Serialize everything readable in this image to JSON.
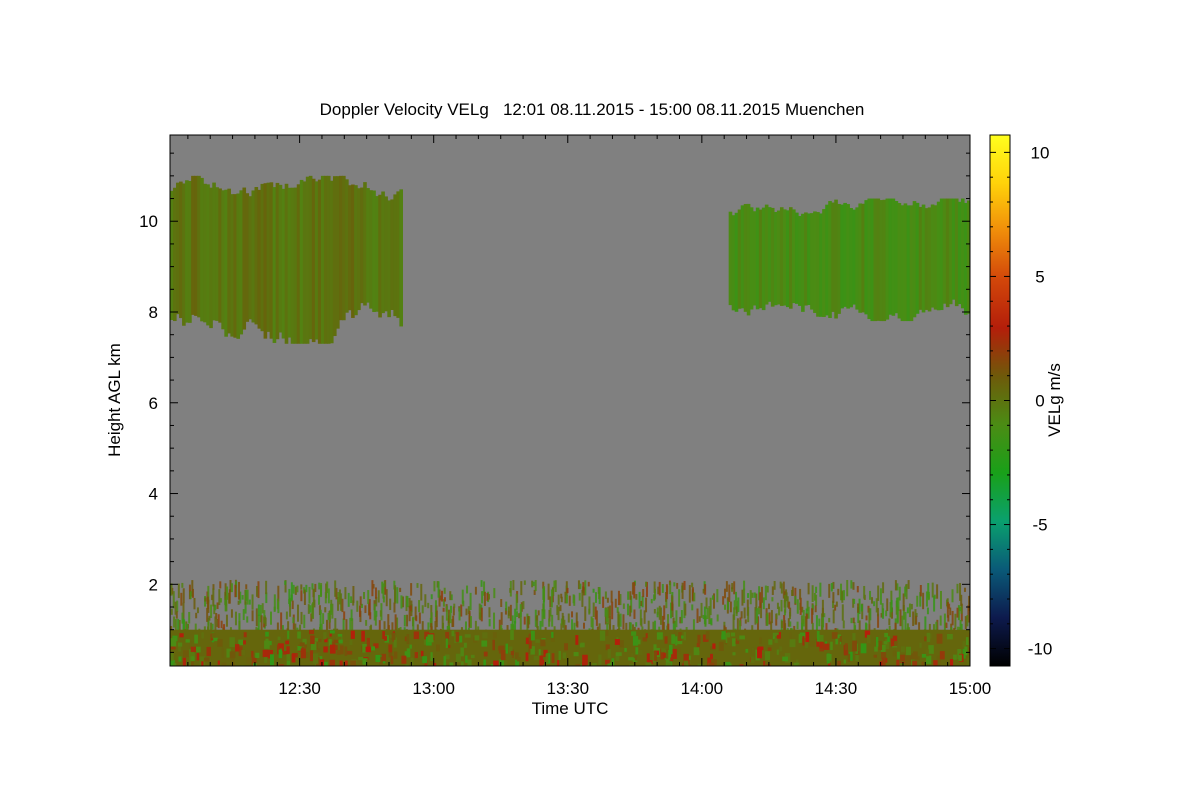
{
  "chart_data": {
    "type": "heatmap",
    "title": "Doppler Velocity VELg   12:01 08.11.2015 - 15:00 08.11.2015 Muenchen",
    "xlabel": "Time UTC",
    "ylabel": "Height AGL km",
    "colorbar_label": "VELg m/s",
    "xlim": [
      "12:01",
      "15:00"
    ],
    "ylim": [
      0.2,
      11.9
    ],
    "x_ticks": [
      "12:30",
      "13:00",
      "13:30",
      "14:00",
      "14:30",
      "15:00"
    ],
    "y_ticks": [
      2,
      4,
      6,
      8,
      10
    ],
    "colorbar_ticks": [
      -10,
      -5,
      0,
      5,
      10
    ],
    "colorbar_range": [
      -10.7,
      10.7
    ],
    "colorscale": [
      "#000000",
      "#0d1a4d",
      "#0a5a78",
      "#0aa06e",
      "#19a019",
      "#4b8c14",
      "#6e5a0a",
      "#b41e0a",
      "#d2460a",
      "#f08c0a",
      "#ffd20a",
      "#ffff1e"
    ],
    "background_color": "#808080",
    "regions": [
      {
        "name": "upper cloud (early)",
        "time": [
          "12:01",
          "12:53"
        ],
        "height_km": [
          7.3,
          11.0
        ],
        "velocity_ms": 0.0
      },
      {
        "name": "upper cloud (late)",
        "time": [
          "14:06",
          "15:00"
        ],
        "height_km": [
          7.8,
          10.5
        ],
        "velocity_ms": -1.0
      },
      {
        "name": "boundary layer noise",
        "time": [
          "12:01",
          "15:00"
        ],
        "height_km": [
          1.0,
          2.1
        ],
        "velocity_ms": 0.0
      },
      {
        "name": "surface layer",
        "time": [
          "12:01",
          "15:00"
        ],
        "height_km": [
          0.2,
          1.0
        ],
        "velocity_ms": 0.5
      }
    ]
  }
}
